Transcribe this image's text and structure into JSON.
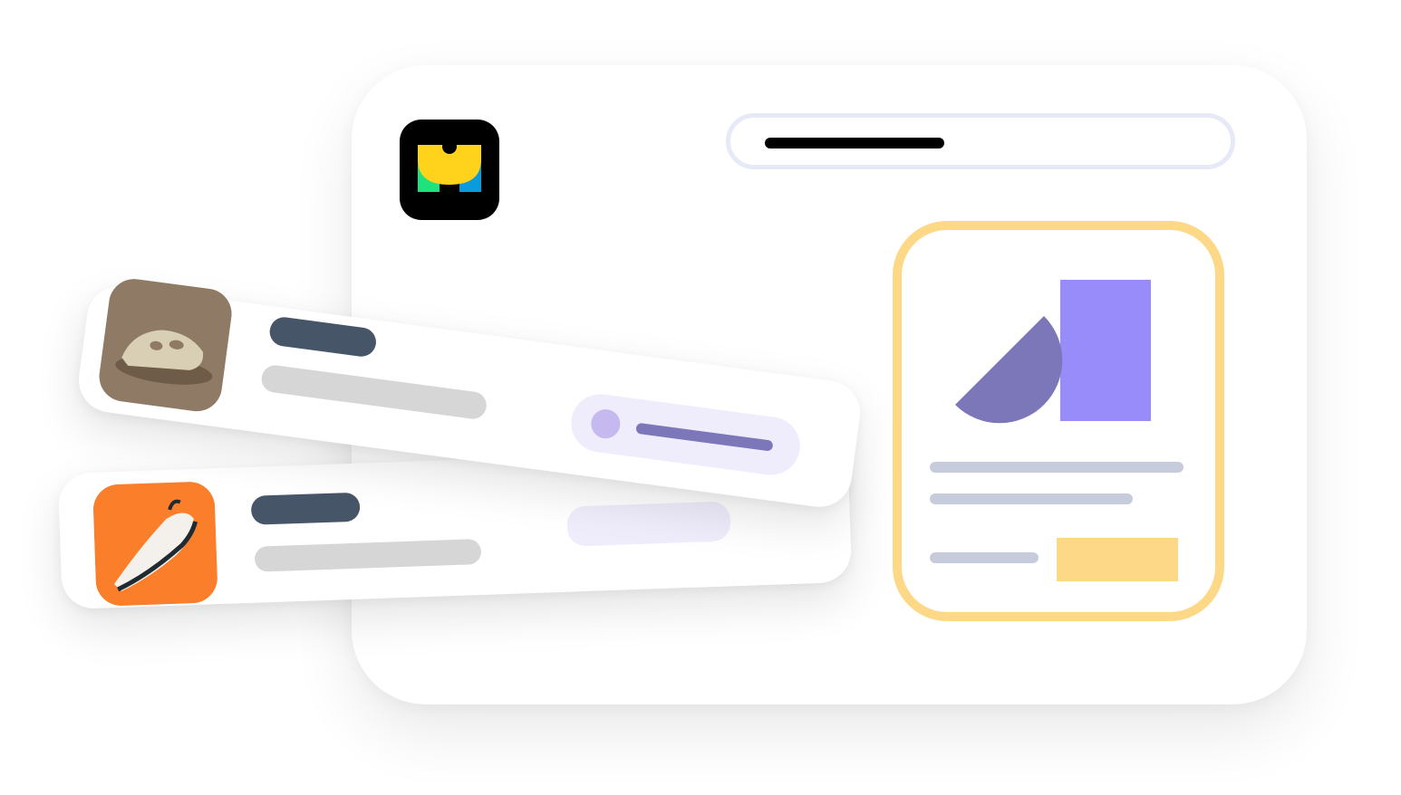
{
  "colors": {
    "window_bg": "#ffffff",
    "url_bar_border": "#e6e9f6",
    "url_text_placeholder": "#000000",
    "card_border": "#fdd987",
    "card_lines": "#c7ccdc",
    "card_cta": "#fdd987",
    "shape_purple_dark": "#7b77b9",
    "shape_purple_light": "#988cfa",
    "title_pill": "#475569",
    "subtitle_pill": "#d6d6d6",
    "badge_bg": "#efedfc",
    "badge_dot": "#c5b9f0",
    "badge_line": "#7b77b9",
    "thumb_front_bg": "#8f7b65",
    "thumb_back_bg": "#fb7e2a"
  },
  "logo": {
    "icon": "brand-logo-icon"
  },
  "product_card": {
    "image_icon": "geometric-shapes-icon"
  },
  "rows": [
    {
      "thumb_icon": "clog-shoe-icon"
    },
    {
      "thumb_icon": "running-sneaker-icon"
    }
  ]
}
